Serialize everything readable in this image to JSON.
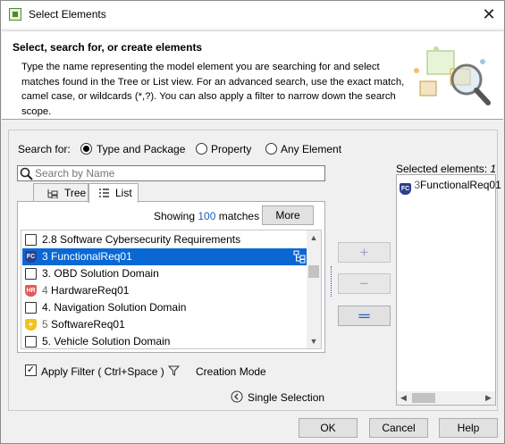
{
  "dialog": {
    "title": "Select Elements",
    "close_glyph": "✕"
  },
  "header": {
    "title": "Select, search for, or create elements",
    "description": "Type the name representing the model element you are searching for and select matches found in the Tree or List view. For an advanced search, use the exact match, camel case, or wildcards (*,?). You can also apply a filter to narrow down the search scope."
  },
  "search": {
    "search_for_label": "Search for:",
    "options": [
      {
        "label": "Type and Package",
        "selected": true
      },
      {
        "label": "Property",
        "selected": false
      },
      {
        "label": "Any Element",
        "selected": false
      }
    ],
    "placeholder": "Search by Name",
    "value": ""
  },
  "tabs": [
    {
      "label": "Tree",
      "icon": "tree-view-icon",
      "active": false
    },
    {
      "label": "List",
      "icon": "list-view-icon",
      "active": true
    }
  ],
  "results": {
    "showing_prefix": "Showing",
    "count": "100",
    "showing_suffix": "matches",
    "more_label": "More",
    "items": [
      {
        "num": "2.8",
        "name": "Software Cybersecurity Requirements",
        "icon": "folder-icon",
        "icon_text": "",
        "selected": false
      },
      {
        "num": "3",
        "name": "FunctionalReq01",
        "icon": "functional-requirement-icon",
        "icon_text": "FC",
        "selected": true
      },
      {
        "num": "3.",
        "name": "OBD Solution Domain",
        "icon": "folder-icon",
        "icon_text": "",
        "selected": false
      },
      {
        "num": "4",
        "name": "HardwareReq01",
        "icon": "hardware-requirement-icon",
        "icon_text": "HR",
        "selected": false
      },
      {
        "num": "4.",
        "name": "Navigation Solution Domain",
        "icon": "folder-icon",
        "icon_text": "",
        "selected": false
      },
      {
        "num": "5",
        "name": "SoftwareReq01",
        "icon": "software-requirement-icon",
        "icon_text": "",
        "selected": false
      },
      {
        "num": "5.",
        "name": "Vehicle Solution Domain",
        "icon": "folder-icon",
        "icon_text": "",
        "selected": false
      }
    ]
  },
  "transfer_buttons": [
    {
      "glyph": "+",
      "name": "add-button",
      "enabled": false
    },
    {
      "glyph": "−",
      "name": "remove-button",
      "enabled": false
    },
    {
      "glyph": "═",
      "name": "remove-all-button",
      "enabled": true
    }
  ],
  "filter": {
    "apply_label": "Apply Filter ( Ctrl+Space )",
    "checked": true,
    "creation_mode_label": "Creation Mode",
    "single_selection_label": "Single Selection"
  },
  "selected": {
    "label": "Selected elements:",
    "count": "1",
    "items": [
      {
        "num": "3",
        "name": "FunctionalReq01",
        "icon_text": "FC"
      }
    ]
  },
  "footer": {
    "ok_label": "OK",
    "cancel_label": "Cancel",
    "help_label": "Help"
  },
  "colors": {
    "selection": "#0a68d4",
    "count_link": "#1a5fc7"
  }
}
